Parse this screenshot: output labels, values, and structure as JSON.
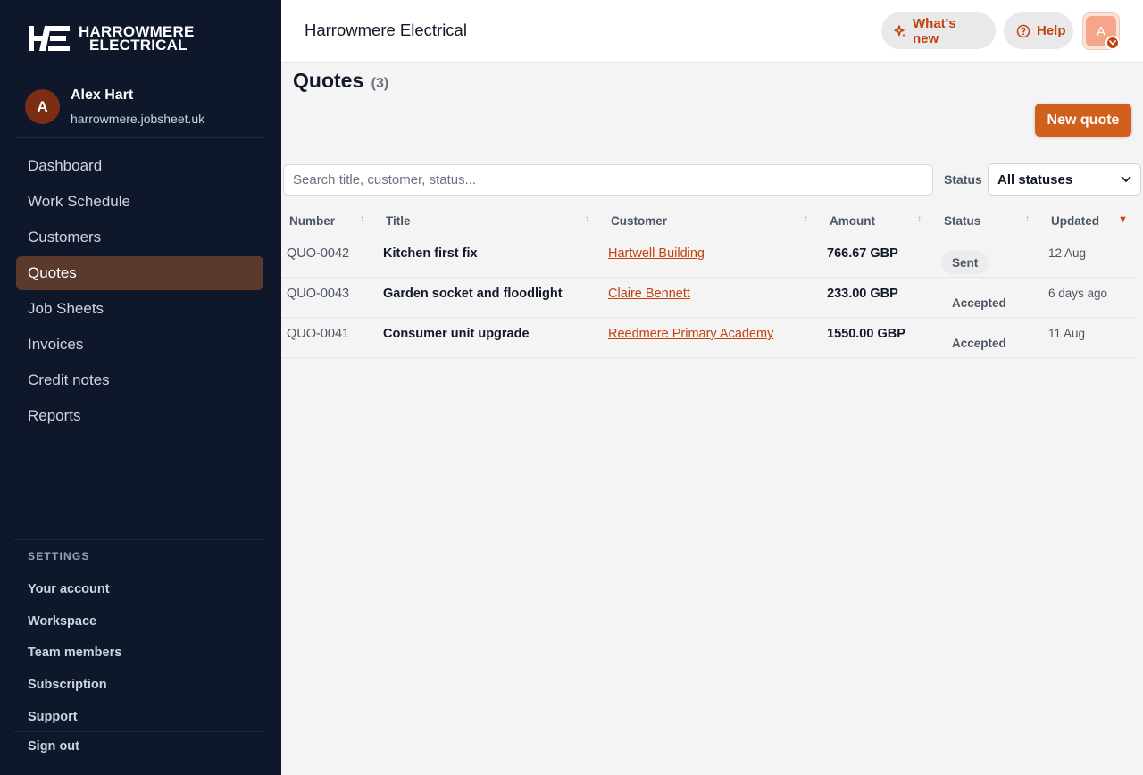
{
  "sidebar": {
    "logo": {
      "mark": "HE",
      "line1": "HARROWMERE",
      "line2": "ELECTRICAL"
    },
    "user": {
      "initial": "A",
      "name": "Alex Hart",
      "domain": "harrowmere.jobsheet.uk"
    },
    "nav": [
      {
        "label": "Dashboard",
        "active": false
      },
      {
        "label": "Work Schedule",
        "active": false
      },
      {
        "label": "Customers",
        "active": false
      },
      {
        "label": "Quotes",
        "active": true
      },
      {
        "label": "Job Sheets",
        "active": false
      },
      {
        "label": "Invoices",
        "active": false
      },
      {
        "label": "Credit notes",
        "active": false
      },
      {
        "label": "Reports",
        "active": false
      }
    ],
    "settings_label": "SETTINGS",
    "settings": [
      {
        "label": "Your account"
      },
      {
        "label": "Workspace"
      },
      {
        "label": "Team members"
      },
      {
        "label": "Subscription"
      },
      {
        "label": "Support"
      }
    ],
    "sign_out": "Sign out"
  },
  "header": {
    "company": "Harrowmere Electrical",
    "whats_new": "What's new",
    "help": "Help",
    "avatar_initial": "A"
  },
  "main": {
    "title": "Quotes",
    "count": "(3)",
    "new_quote": "New quote",
    "search_placeholder": "Search title, customer, status...",
    "status_label": "Status",
    "status_selected": "All statuses"
  },
  "table": {
    "columns": {
      "number": "Number",
      "title": "Title",
      "customer": "Customer",
      "amount": "Amount",
      "status": "Status",
      "updated": "Updated"
    },
    "rows": [
      {
        "number": "QUO-0042",
        "title": "Kitchen first fix",
        "customer": "Hartwell Building",
        "amount": "766.67 GBP",
        "status": "Sent",
        "updated": "12 Aug"
      },
      {
        "number": "QUO-0043",
        "title": "Garden socket and floodlight",
        "customer": "Claire Bennett",
        "amount": "233.00 GBP",
        "status": "Accepted",
        "updated": "6 days ago"
      },
      {
        "number": "QUO-0041",
        "title": "Consumer unit upgrade",
        "customer": "Reedmere Primary Academy",
        "amount": "1550.00 GBP",
        "status": "Accepted",
        "updated": "11 Aug"
      }
    ]
  },
  "colors": {
    "sidebar_bg": "#0f172a",
    "accent": "#c2410c",
    "active_nav": "#5b3a2e",
    "button": "#d35f1c"
  },
  "icons": [
    "sparkle-icon",
    "help-circle-icon",
    "chevron-down-icon",
    "sort-icon",
    "sort-desc-icon"
  ]
}
